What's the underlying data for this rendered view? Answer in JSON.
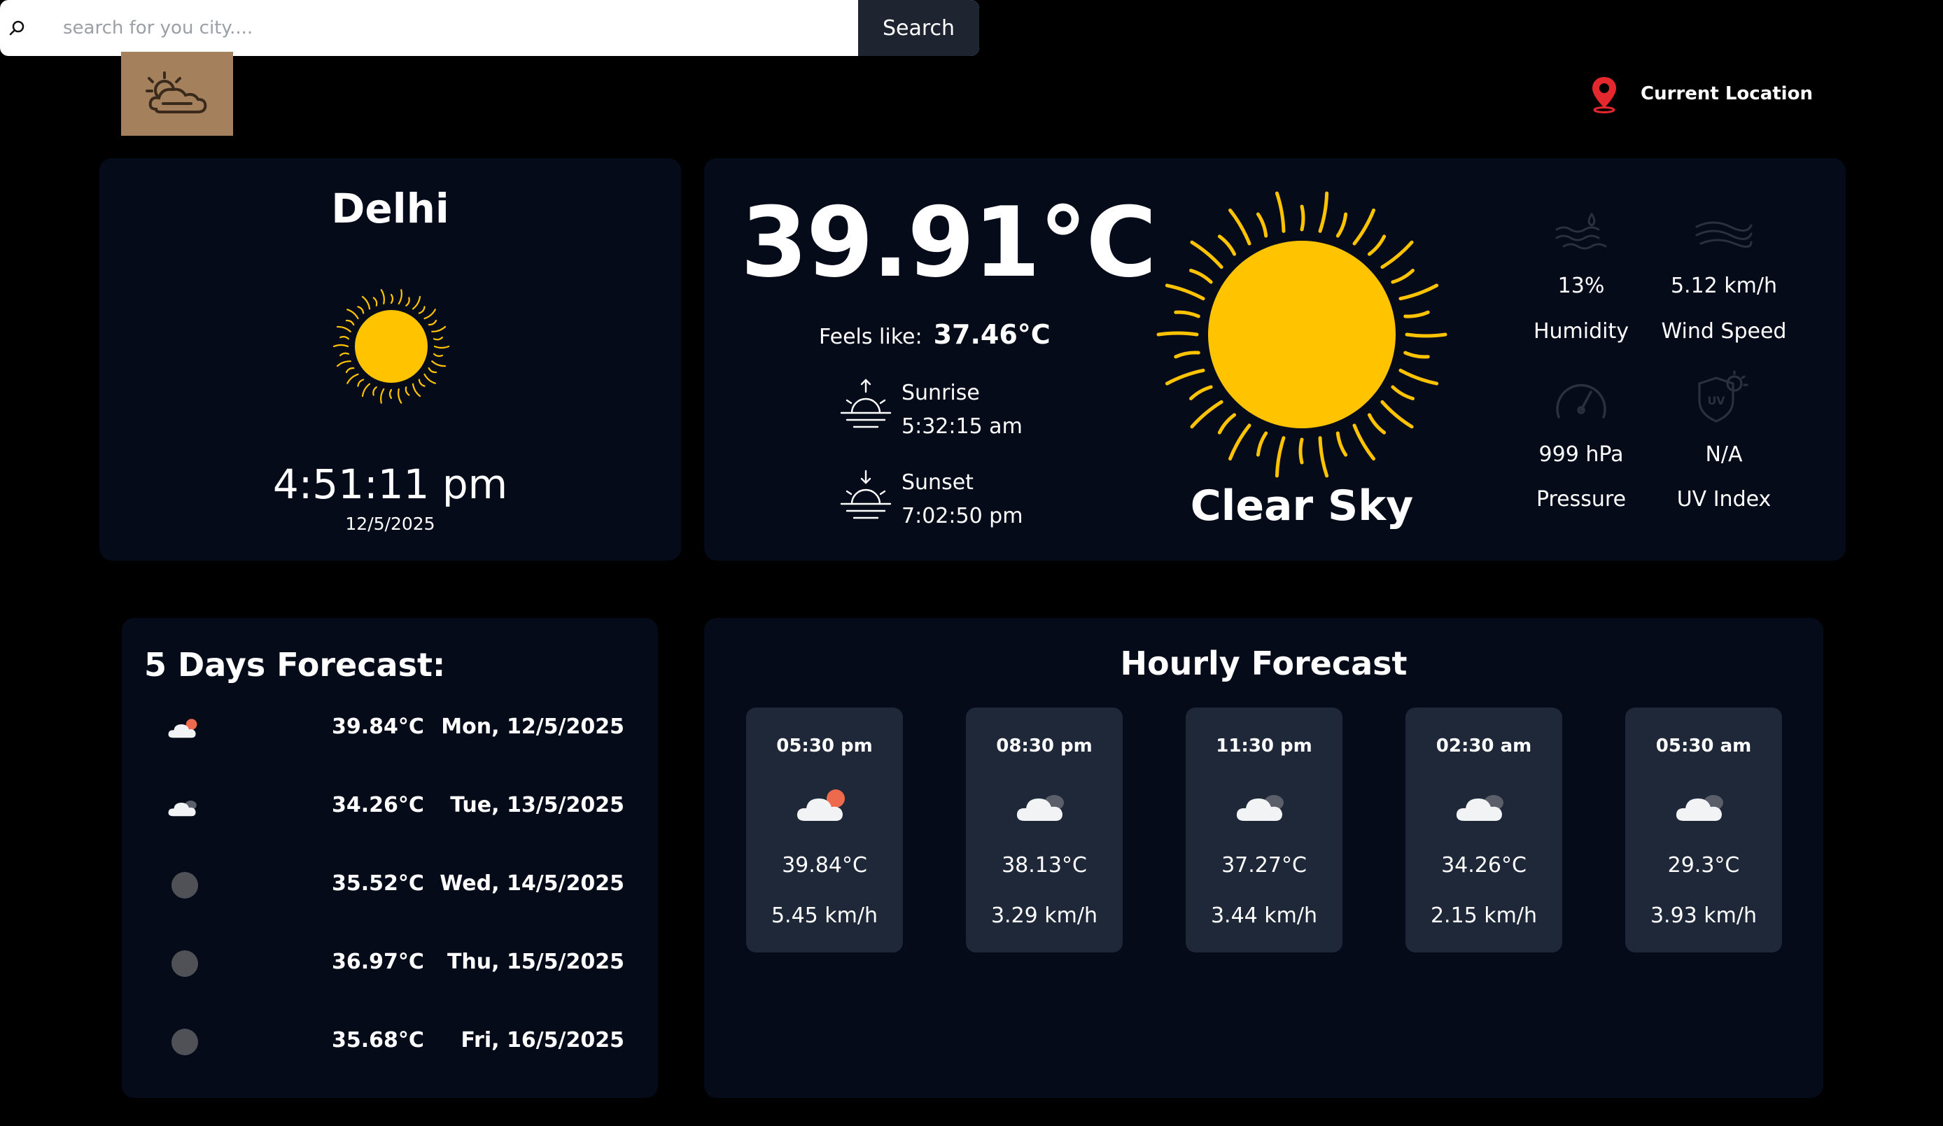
{
  "header": {
    "search_placeholder": "search for you city....",
    "search_button": "Search",
    "current_location": "Current Location"
  },
  "city": {
    "name": "Delhi",
    "time": "4:51:11 pm",
    "date": "12/5/2025"
  },
  "current": {
    "temperature": "39.91°C",
    "feels_like_label": "Feels like:",
    "feels_like_value": "37.46°C",
    "sunrise_label": "Sunrise",
    "sunrise_time": "5:32:15 am",
    "sunset_label": "Sunset",
    "sunset_time": "7:02:50 pm",
    "condition": "Clear Sky",
    "humidity_value": "13%",
    "humidity_label": "Humidity",
    "wind_value": "5.12 km/h",
    "wind_label": "Wind Speed",
    "pressure_value": "999 hPa",
    "pressure_label": "Pressure",
    "uv_value": "N/A",
    "uv_label": "UV Index"
  },
  "days": {
    "title": "5 Days Forecast:",
    "items": [
      {
        "icon": "cloud-sun-icon",
        "temp": "39.84°C",
        "date": "Mon, 12/5/2025"
      },
      {
        "icon": "cloud-icon",
        "temp": "34.26°C",
        "date": "Tue, 13/5/2025"
      },
      {
        "icon": "moon-icon",
        "temp": "35.52°C",
        "date": "Wed, 14/5/2025"
      },
      {
        "icon": "moon-icon",
        "temp": "36.97°C",
        "date": "Thu, 15/5/2025"
      },
      {
        "icon": "moon-icon",
        "temp": "35.68°C",
        "date": "Fri, 16/5/2025"
      }
    ]
  },
  "hourly": {
    "title": "Hourly Forecast",
    "items": [
      {
        "time": "05:30 pm",
        "icon": "cloud-sun-icon",
        "temp": "39.84°C",
        "wind": "5.45 km/h"
      },
      {
        "time": "08:30 pm",
        "icon": "cloud-icon",
        "temp": "38.13°C",
        "wind": "3.29 km/h"
      },
      {
        "time": "11:30 pm",
        "icon": "cloud-icon",
        "temp": "37.27°C",
        "wind": "3.44 km/h"
      },
      {
        "time": "02:30 am",
        "icon": "cloud-icon",
        "temp": "34.26°C",
        "wind": "2.15 km/h"
      },
      {
        "time": "05:30 am",
        "icon": "cloud-icon",
        "temp": "29.3°C",
        "wind": "3.93 km/h"
      }
    ]
  },
  "colors": {
    "background": "#000000",
    "card": "#050b19",
    "hour_card": "#1e2839",
    "sun": "#ffc300",
    "logo_bg": "#a4805c",
    "location_pin": "#e5272e"
  }
}
